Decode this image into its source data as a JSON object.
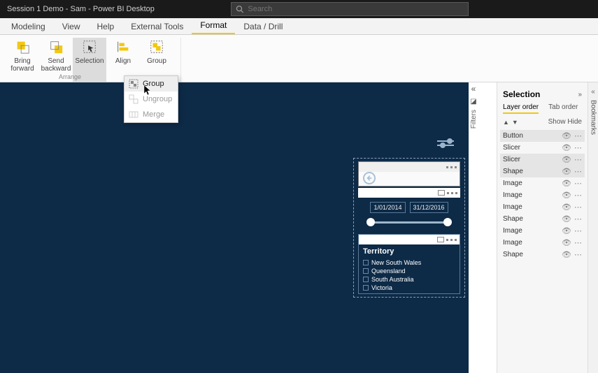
{
  "titlebar": {
    "title": "Session 1 Demo - Sam - Power BI Desktop",
    "search_placeholder": "Search"
  },
  "ribbon_tabs": [
    "Modeling",
    "View",
    "Help",
    "External Tools",
    "Format",
    "Data / Drill"
  ],
  "active_tab": "Format",
  "ribbon": {
    "bring_forward": "Bring forward",
    "send_backward": "Send backward",
    "selection": "Selection",
    "align": "Align",
    "group": "Group",
    "group_label": "Arrange"
  },
  "dropdown": {
    "group": "Group",
    "ungroup": "Ungroup",
    "merge": "Merge"
  },
  "filters_label": "Filters",
  "selection_pane": {
    "header": "Selection",
    "layer_order": "Layer order",
    "tab_order": "Tab order",
    "show": "Show",
    "hide": "Hide",
    "items": [
      {
        "label": "Button",
        "selected": true
      },
      {
        "label": "Slicer",
        "selected": false
      },
      {
        "label": "Slicer",
        "selected": true
      },
      {
        "label": "Shape",
        "selected": true
      },
      {
        "label": "Image",
        "selected": false
      },
      {
        "label": "Image",
        "selected": false
      },
      {
        "label": "Image",
        "selected": false
      },
      {
        "label": "Shape",
        "selected": false
      },
      {
        "label": "Image",
        "selected": false
      },
      {
        "label": "Image",
        "selected": false
      },
      {
        "label": "Shape",
        "selected": false
      }
    ]
  },
  "bookmarks_label": "Bookmarks",
  "date_slicer": {
    "start": "1/01/2014",
    "end": "31/12/2016"
  },
  "territory_slicer": {
    "title": "Territory",
    "options": [
      "New South Wales",
      "Queensland",
      "South Australia",
      "Victoria"
    ]
  }
}
